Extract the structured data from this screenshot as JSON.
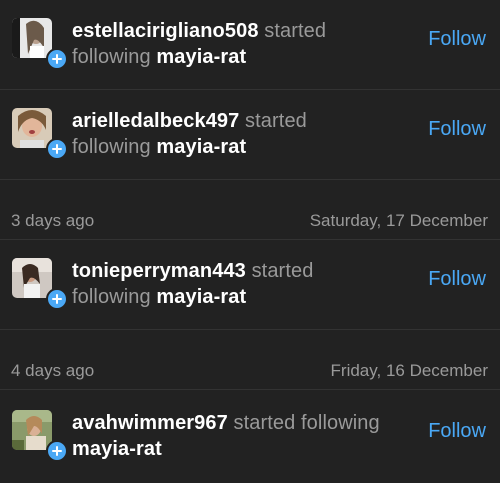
{
  "notifications_top": [
    {
      "username": "estellacirigliano508",
      "action": "started",
      "action2": "following",
      "target": "mayia-rat",
      "follow_label": "Follow"
    },
    {
      "username": "arielledalbeck497",
      "action": "started",
      "action2": "following",
      "target": "mayia-rat",
      "follow_label": "Follow"
    }
  ],
  "section_1": {
    "relative": "3 days ago",
    "date": "Saturday, 17 December"
  },
  "notifications_mid": [
    {
      "username": "tonieperryman443",
      "action": "started",
      "action2": "following",
      "target": "mayia-rat",
      "follow_label": "Follow"
    }
  ],
  "section_2": {
    "relative": "4 days ago",
    "date": "Friday, 16 December"
  },
  "notifications_bottom": [
    {
      "username": "avahwimmer967",
      "action": "started following",
      "target": "mayia-rat",
      "follow_label": "Follow"
    }
  ],
  "colors": {
    "accent": "#4aa8f5",
    "background": "#222222",
    "muted": "#9a9a9a"
  }
}
